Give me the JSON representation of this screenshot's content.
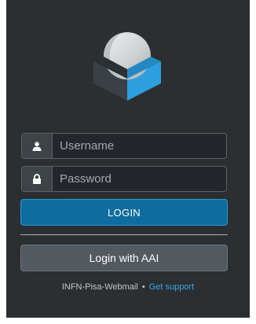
{
  "login_form": {
    "username_placeholder": "Username",
    "password_placeholder": "Password",
    "login_label": "LOGIN",
    "aai_label": "Login with AAI"
  },
  "footer": {
    "product_name": "INFN-Pisa-Webmail",
    "separator": "•",
    "support_link": "Get support"
  },
  "colors": {
    "panel_background": "#2c2f32",
    "primary_button": "#0f6c9e",
    "secondary_button": "#525a5f",
    "link": "#37a9e6",
    "logo_blue": "#2e9fde"
  }
}
